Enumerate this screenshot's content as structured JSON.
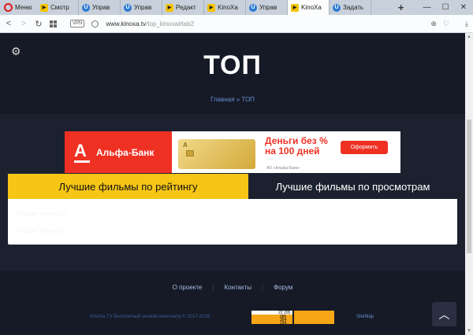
{
  "browser": {
    "menu_label": "Меню",
    "tabs": [
      {
        "label": "Смотр",
        "icon": "play"
      },
      {
        "label": "Управ",
        "icon": "u"
      },
      {
        "label": "Управ",
        "icon": "u"
      },
      {
        "label": "Редакт",
        "icon": "play"
      },
      {
        "label": "KinoXa",
        "icon": "play"
      },
      {
        "label": "Управ",
        "icon": "u"
      },
      {
        "label": "KinoXa",
        "icon": "kinoxa",
        "active": true
      },
      {
        "label": "Задать",
        "icon": "u"
      }
    ],
    "new_tab": "+",
    "vpn": "VPN",
    "url_host": "www.kinoxa.tv",
    "url_path": "/top_kinoxa#tab2"
  },
  "page": {
    "title": "ТОП",
    "breadcrumb": "Главная » ТОП"
  },
  "ad": {
    "brand": "Альфа-Банк",
    "headline": "Деньги без % на 100 дней",
    "button": "Оформить",
    "fine_print": "АО «Альфа-Банк»"
  },
  "tabs": {
    "rating": "Лучшие фильмы по рейтингу",
    "views": "Лучшие фильмы по просмотрам"
  },
  "panel": {
    "line1": "Раздел пока пуст",
    "line2": "Раздел пока пуст"
  },
  "footer": {
    "links": [
      "О проекте",
      "Контакты",
      "Форум"
    ],
    "copyright": "KinoXa.TV Бесплатный онлайн кинотеатр © 2017-2018",
    "sitemap": "SiteMap",
    "counter_total": "22 205",
    "counter_rows": [
      "985",
      "364",
      "154"
    ]
  },
  "colors": {
    "accent_yellow": "#f6c516",
    "alfa_red": "#ef3124",
    "page_bg": "#1c2130"
  }
}
